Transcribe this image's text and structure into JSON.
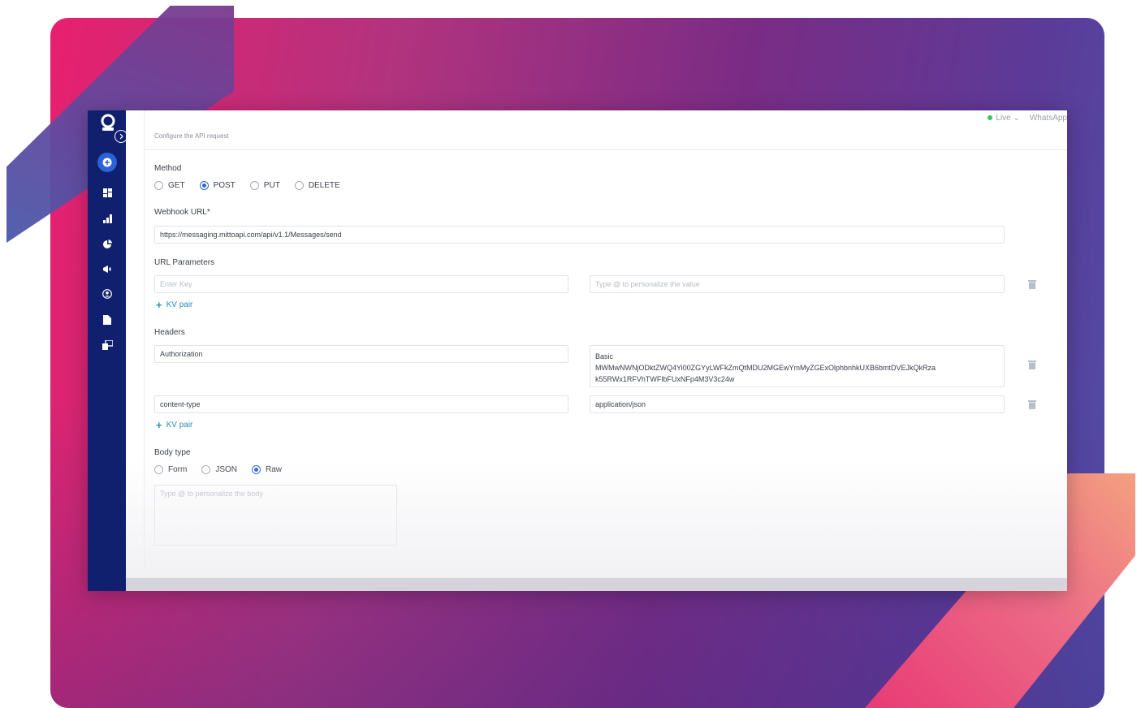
{
  "topbar": {
    "status": "Live",
    "channel": "WhatsApp"
  },
  "section": {
    "subtitle": "Configure the API request"
  },
  "method": {
    "label": "Method",
    "options": [
      "GET",
      "POST",
      "PUT",
      "DELETE"
    ],
    "selected": "POST"
  },
  "webhook": {
    "label": "Webhook URL*",
    "value": "https://messaging.mittoapi.com/api/v1.1/Messages/send"
  },
  "url_params": {
    "label": "URL Parameters",
    "key_placeholder": "Enter Key",
    "value_placeholder": "Type @ to personalize the value",
    "add_label": "KV pair"
  },
  "headers": {
    "label": "Headers",
    "rows": [
      {
        "key": "Authorization",
        "value_line1": "Basic",
        "value_line2": "MWMwNWNjODktZWQ4Yi00ZGYyLWFkZmQtMDU2MGEwYmMyZGExOlphbnhkUXB6bmtDVEJkQkRza",
        "value_line3": "k55RWx1RFVhTWFlbFUxNFp4M3V3c24w"
      },
      {
        "key": "content-type",
        "value": "application/json"
      }
    ],
    "add_label": "KV pair"
  },
  "body": {
    "label": "Body type",
    "options": [
      "Form",
      "JSON",
      "Raw"
    ],
    "selected": "Raw",
    "placeholder": "Type @ to personalize the body"
  },
  "colors": {
    "sidebar": "#10206e",
    "accent": "#2b62d8",
    "link": "#2a8fb6",
    "live": "#39c26e"
  }
}
